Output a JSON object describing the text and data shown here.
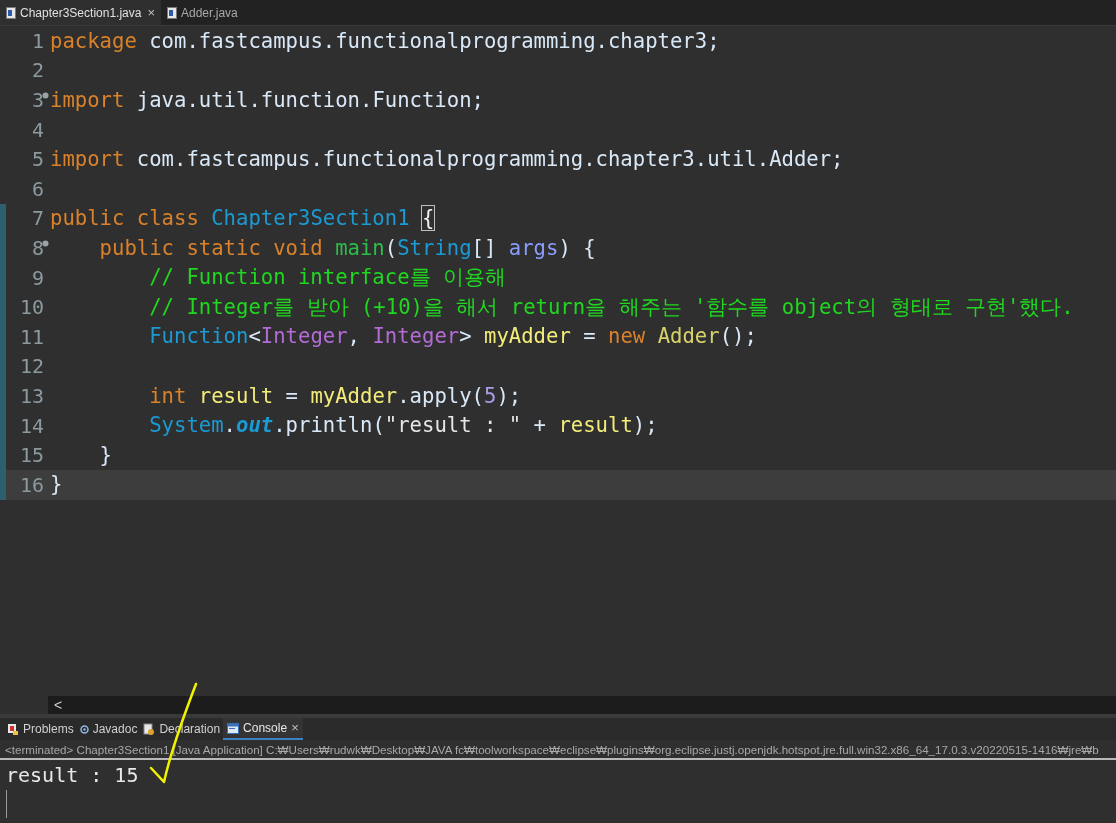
{
  "editor_tabs": [
    {
      "label": "Chapter3Section1.java",
      "selected": true,
      "close": "×"
    },
    {
      "label": "Adder.java",
      "selected": false
    }
  ],
  "code_lines": [
    {
      "number": "1",
      "foldable": false,
      "changed": false,
      "current": false,
      "tokens": [
        {
          "kind": "keyword",
          "t": "package"
        },
        {
          "kind": "plain",
          "t": " com.fastcampus.functionalprogramming.chapter3;"
        }
      ]
    },
    {
      "number": "2",
      "foldable": false,
      "changed": false,
      "current": false
    },
    {
      "number": "3",
      "foldable": true,
      "changed": false,
      "current": false,
      "tokens": [
        {
          "kind": "keyword",
          "t": "import"
        },
        {
          "kind": "plain",
          "t": " java.util.function.Function;"
        }
      ]
    },
    {
      "number": "4",
      "foldable": false,
      "changed": false,
      "current": false
    },
    {
      "number": "5",
      "foldable": false,
      "changed": false,
      "current": false,
      "tokens": [
        {
          "kind": "keyword",
          "t": "import"
        },
        {
          "kind": "plain",
          "t": " com.fastcampus.functionalprogramming.chapter3.util.Adder;"
        }
      ]
    },
    {
      "number": "6",
      "foldable": false,
      "changed": false,
      "current": false
    },
    {
      "number": "7",
      "foldable": false,
      "changed": true,
      "current": false,
      "tokens": [
        {
          "kind": "keyword",
          "t": "public class "
        },
        {
          "kind": "type",
          "t": "Chapter3Section1 "
        },
        {
          "kind": "bracket",
          "t": "{"
        }
      ]
    },
    {
      "number": "8",
      "foldable": true,
      "changed": true,
      "current": false,
      "tokens": [
        {
          "kind": "keyword",
          "t": "    public static void "
        },
        {
          "kind": "method",
          "t": "main"
        },
        {
          "kind": "plain",
          "t": "("
        },
        {
          "kind": "type",
          "t": "String"
        },
        {
          "kind": "plain",
          "t": "[] "
        },
        {
          "kind": "param",
          "t": "args"
        },
        {
          "kind": "plain",
          "t": ") {"
        }
      ]
    },
    {
      "number": "9",
      "foldable": false,
      "changed": true,
      "current": false,
      "tokens": [
        {
          "kind": "comment",
          "t": "        // Function interface를 이용해"
        }
      ]
    },
    {
      "number": "10",
      "foldable": false,
      "changed": true,
      "current": false,
      "tokens": [
        {
          "kind": "comment",
          "t": "        // Integer를 받아 (+10)을 해서 return을 해주는 '함수를 object의 형태로 구현'했다."
        }
      ]
    },
    {
      "number": "11",
      "foldable": false,
      "changed": true,
      "current": false,
      "tokens": [
        {
          "kind": "type",
          "t": "        Function"
        },
        {
          "kind": "plain",
          "t": "<"
        },
        {
          "kind": "typearg",
          "t": "Integer"
        },
        {
          "kind": "plain",
          "t": ", "
        },
        {
          "kind": "typearg",
          "t": "Integer"
        },
        {
          "kind": "plain",
          "t": "> "
        },
        {
          "kind": "local",
          "t": "myAdder"
        },
        {
          "kind": "plain",
          "t": " = "
        },
        {
          "kind": "keyword",
          "t": "new "
        },
        {
          "kind": "class",
          "t": "Adder"
        },
        {
          "kind": "plain",
          "t": "();"
        }
      ]
    },
    {
      "number": "12",
      "foldable": false,
      "changed": true,
      "current": false
    },
    {
      "number": "13",
      "foldable": false,
      "changed": true,
      "current": false,
      "tokens": [
        {
          "kind": "keyword",
          "t": "        int "
        },
        {
          "kind": "local",
          "t": "result"
        },
        {
          "kind": "plain",
          "t": " = "
        },
        {
          "kind": "local",
          "t": "myAdder"
        },
        {
          "kind": "plain",
          "t": ".apply("
        },
        {
          "kind": "number",
          "t": "5"
        },
        {
          "kind": "plain",
          "t": ");"
        }
      ]
    },
    {
      "number": "14",
      "foldable": false,
      "changed": true,
      "current": false,
      "tokens": [
        {
          "kind": "type",
          "t": "        System"
        },
        {
          "kind": "plain",
          "t": "."
        },
        {
          "kind": "field",
          "t": "out"
        },
        {
          "kind": "plain",
          "t": ".println("
        },
        {
          "kind": "string",
          "t": "\"result : \""
        },
        {
          "kind": "plain",
          "t": " + "
        },
        {
          "kind": "local",
          "t": "result"
        },
        {
          "kind": "plain",
          "t": ");"
        }
      ]
    },
    {
      "number": "15",
      "foldable": false,
      "changed": true,
      "current": false,
      "tokens": [
        {
          "kind": "plain",
          "t": "    }"
        }
      ]
    },
    {
      "number": "16",
      "foldable": false,
      "changed": true,
      "current": true,
      "tokens": [
        {
          "kind": "plain",
          "t": "}"
        }
      ]
    }
  ],
  "horizontal_scroll": {
    "arrow": "<"
  },
  "panel_tabs": [
    {
      "label": "Problems",
      "kind": "problems",
      "selected": false
    },
    {
      "label": "Javadoc",
      "kind": "javadoc",
      "selected": false
    },
    {
      "label": "Declaration",
      "kind": "declaration",
      "selected": false
    },
    {
      "label": "Console",
      "kind": "console",
      "selected": true,
      "close": "×"
    }
  ],
  "console": {
    "header": "<terminated> Chapter3Section1 [Java Application] C:₩Users₩rudwk₩Desktop₩JAVA fc₩toolworkspace₩eclipse₩plugins₩org.eclipse.justj.openjdk.hotspot.jre.full.win32.x86_64_17.0.3.v20220515-1416₩jre₩b",
    "output": [
      "result : 15"
    ]
  }
}
